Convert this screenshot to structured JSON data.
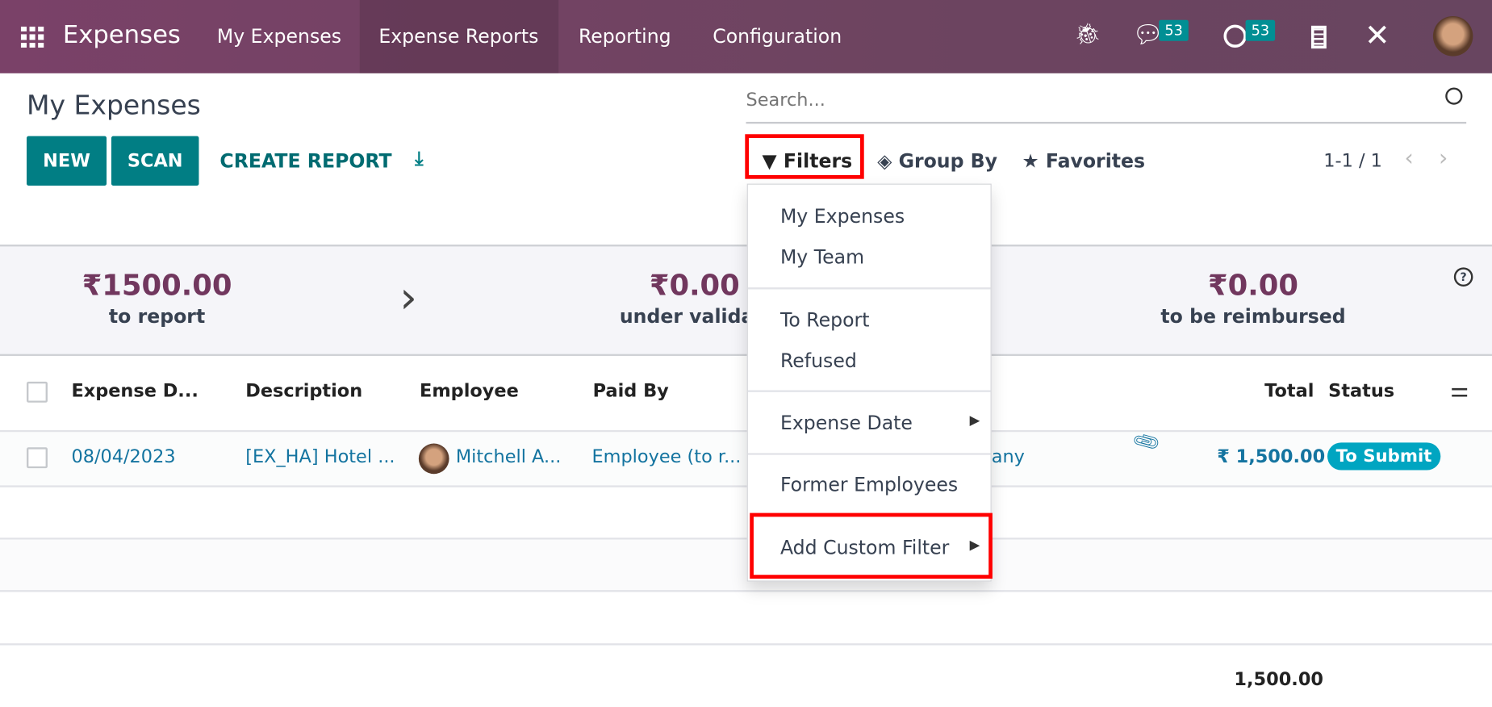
{
  "app": {
    "name": "Expenses",
    "menu": [
      "My Expenses",
      "Expense Reports",
      "Reporting",
      "Configuration"
    ],
    "active_menu": "Expense Reports",
    "messages_count": "53",
    "activities_count": "53"
  },
  "page": {
    "title": "My Expenses",
    "new_label": "NEW",
    "scan_label": "SCAN",
    "create_report_label": "CREATE REPORT"
  },
  "search": {
    "placeholder": "Search...",
    "filters_label": "Filters",
    "group_by_label": "Group By",
    "favorites_label": "Favorites",
    "pager": "1-1 / 1"
  },
  "stats": [
    {
      "amount": "₹1500.00",
      "label": "to report"
    },
    {
      "amount": "₹0.00",
      "label": "under validati"
    },
    {
      "amount": "₹0.00",
      "label": "to be reimbursed"
    }
  ],
  "filters_menu": [
    "My Expenses",
    "My Team",
    "To Report",
    "Refused",
    "Expense Date",
    "Former Employees",
    "Add Custom Filter"
  ],
  "table": {
    "columns": [
      "Expense D...",
      "Description",
      "Employee",
      "Paid By",
      "Total",
      "Status"
    ],
    "rows": [
      {
        "date": "08/04/2023",
        "description": "[EX_HA] Hotel ...",
        "employee": "Mitchell A...",
        "paid_by": "Employee (to r...",
        "company": "any",
        "total": "₹ 1,500.00",
        "status": "To Submit"
      }
    ],
    "footer_total": "1,500.00"
  },
  "colors": {
    "navbar": "#714b67",
    "primary": "#017e84",
    "status_badge": "#00a5c1",
    "highlight_box": "#ff0000"
  }
}
